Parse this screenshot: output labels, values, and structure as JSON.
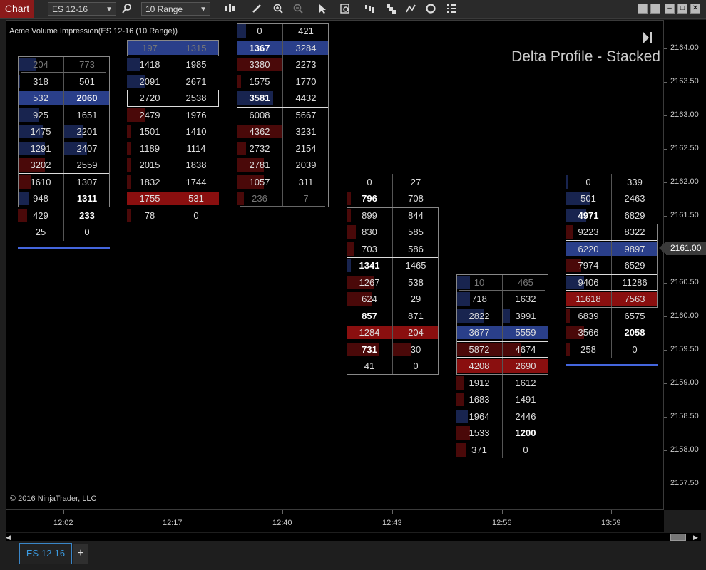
{
  "toolbar": {
    "chart_label": "Chart",
    "instrument": "ES 12-16",
    "interval": "10 Range"
  },
  "chart": {
    "indicator_title": "Acme Volume Impression(ES 12-16 (10 Range))",
    "heading": "Delta Profile - Stacked",
    "copyright": "© 2016 NinjaTrader, LLC",
    "current_price": "2161.00"
  },
  "yaxis_labels": [
    "2164.00",
    "2163.50",
    "2163.00",
    "2162.50",
    "2162.00",
    "2161.50",
    "2161.00",
    "2160.50",
    "2160.00",
    "2159.50",
    "2159.00",
    "2158.50",
    "2158.00",
    "2157.50"
  ],
  "xaxis_labels": [
    "12:02",
    "12:17",
    "12:40",
    "12:43",
    "12:56",
    "13:59"
  ],
  "tab": {
    "label": "ES 12-16",
    "add": "+"
  },
  "colors": {
    "bid_red": "#8a0f0f",
    "ask_blue": "#2a3f8a",
    "bg": "#000000"
  },
  "bars": [
    {
      "time": "12:02",
      "top_row": 1,
      "rows": [
        {
          "l": "204",
          "r": "773",
          "lb": 0.4,
          "lc": "b",
          "rb": 0,
          "rc": "b",
          "head": true
        },
        {
          "l": "318",
          "r": "501",
          "lb": 0.05,
          "lc": "b",
          "rb": 0,
          "rc": "b"
        },
        {
          "l": "532",
          "r": "2060",
          "lb": 1,
          "lc": "B",
          "rb": 1,
          "rc": "B",
          "rbold": true
        },
        {
          "l": "925",
          "r": "1651",
          "lb": 0.45,
          "lc": "b",
          "rb": 0,
          "rc": "b"
        },
        {
          "l": "1475",
          "r": "2201",
          "lb": 0.55,
          "lc": "b",
          "rb": 0.4,
          "rc": "b"
        },
        {
          "l": "1291",
          "r": "2407",
          "lb": 0.6,
          "lc": "b",
          "rb": 0.5,
          "rc": "b"
        },
        {
          "l": "3202",
          "r": "2559",
          "lb": 0.6,
          "lc": "r",
          "rb": 0,
          "rc": "b",
          "box": true
        },
        {
          "l": "1610",
          "r": "1307",
          "lb": 0.3,
          "lc": "r",
          "rb": 0,
          "rc": "b"
        },
        {
          "l": "948",
          "r": "1311",
          "lb": 0.25,
          "lc": "b",
          "rb": 0,
          "rc": "b",
          "rbold": true
        },
        {
          "l": "429",
          "r": "233",
          "lb": 0.2,
          "lc": "r",
          "rb": 0,
          "rc": "b",
          "rbold": true
        },
        {
          "l": "25",
          "r": "0",
          "lb": 0,
          "lc": "b",
          "rb": 0,
          "rc": "b"
        }
      ],
      "underline": true
    },
    {
      "time": "12:17",
      "top_row": 0,
      "rows": [
        {
          "l": "197",
          "r": "1315",
          "lb": 1,
          "lc": "B",
          "rb": 1,
          "rc": "B",
          "head": true
        },
        {
          "l": "1418",
          "r": "1985",
          "lb": 0.3,
          "lc": "b",
          "rb": 0,
          "rc": "b"
        },
        {
          "l": "2091",
          "r": "2671",
          "lb": 0.4,
          "lc": "b",
          "rb": 0,
          "rc": "b"
        },
        {
          "l": "2720",
          "r": "2538",
          "lb": 0,
          "lc": "b",
          "rb": 0,
          "rc": "b",
          "box": true
        },
        {
          "l": "2479",
          "r": "1976",
          "lb": 0.4,
          "lc": "r",
          "rb": 0,
          "rc": "b"
        },
        {
          "l": "1501",
          "r": "1410",
          "lb": 0.1,
          "lc": "r",
          "rb": 0,
          "rc": "b"
        },
        {
          "l": "1189",
          "r": "1114",
          "lb": 0.1,
          "lc": "r",
          "rb": 0,
          "rc": "b"
        },
        {
          "l": "2015",
          "r": "1838",
          "lb": 0.1,
          "lc": "r",
          "rb": 0,
          "rc": "b"
        },
        {
          "l": "1832",
          "r": "1744",
          "lb": 0.1,
          "lc": "r",
          "rb": 0,
          "rc": "b"
        },
        {
          "l": "1755",
          "r": "531",
          "lb": 1,
          "lc": "R",
          "rb": 1,
          "rc": "R"
        },
        {
          "l": "78",
          "r": "0",
          "lb": 0.1,
          "lc": "r",
          "rb": 0,
          "rc": "b"
        }
      ]
    },
    {
      "time": "12:40",
      "top_row": -1,
      "rows": [
        {
          "l": "0",
          "r": "421",
          "lb": 0.2,
          "lc": "b",
          "rb": 0,
          "rc": "b"
        },
        {
          "l": "1367",
          "r": "3284",
          "lb": 1,
          "lc": "B",
          "rb": 1,
          "rc": "B",
          "lbold": true
        },
        {
          "l": "3380",
          "r": "2273",
          "lb": 1,
          "lc": "r",
          "rb": 0,
          "rc": "b"
        },
        {
          "l": "1575",
          "r": "1770",
          "lb": 0.1,
          "lc": "r",
          "rb": 0,
          "rc": "b"
        },
        {
          "l": "3581",
          "r": "4432",
          "lb": 0.8,
          "lc": "b",
          "rb": 0,
          "rc": "b",
          "lbold": true
        },
        {
          "l": "6008",
          "r": "5667",
          "lb": 0,
          "lc": "b",
          "rb": 0,
          "rc": "b",
          "box": true
        },
        {
          "l": "4362",
          "r": "3231",
          "lb": 1,
          "lc": "r",
          "rb": 0,
          "rc": "b"
        },
        {
          "l": "2732",
          "r": "2154",
          "lb": 0.2,
          "lc": "r",
          "rb": 0,
          "rc": "b"
        },
        {
          "l": "2781",
          "r": "2039",
          "lb": 0.6,
          "lc": "r",
          "rb": 0,
          "rc": "b"
        },
        {
          "l": "1057",
          "r": "311",
          "lb": 0.6,
          "lc": "r",
          "rb": 0,
          "rc": "b"
        },
        {
          "l": "236",
          "r": "7",
          "lb": 0.15,
          "lc": "r",
          "rb": 0,
          "rc": "b",
          "head": true
        }
      ]
    },
    {
      "time": "12:43",
      "top_row": 8,
      "rows": [
        {
          "l": "0",
          "r": "27",
          "lb": 0,
          "lc": "b",
          "rb": 0,
          "rc": "b"
        },
        {
          "l": "796",
          "r": "708",
          "lb": 0.1,
          "lc": "r",
          "rb": 0,
          "rc": "b",
          "lbold": true
        },
        {
          "l": "899",
          "r": "844",
          "lb": 0.1,
          "lc": "r",
          "rb": 0,
          "rc": "b"
        },
        {
          "l": "830",
          "r": "585",
          "lb": 0.2,
          "lc": "r",
          "rb": 0,
          "rc": "b"
        },
        {
          "l": "703",
          "r": "586",
          "lb": 0.15,
          "lc": "r",
          "rb": 0,
          "rc": "b"
        },
        {
          "l": "1341",
          "r": "1465",
          "lb": 0.1,
          "lc": "b",
          "rb": 0,
          "rc": "b",
          "box": true,
          "lbold": true
        },
        {
          "l": "1267",
          "r": "538",
          "lb": 0.6,
          "lc": "r",
          "rb": 0,
          "rc": "b"
        },
        {
          "l": "624",
          "r": "29",
          "lb": 0.55,
          "lc": "r",
          "rb": 0,
          "rc": "b"
        },
        {
          "l": "857",
          "r": "871",
          "lb": 0,
          "lc": "b",
          "rb": 0,
          "rc": "b",
          "lbold": true
        },
        {
          "l": "1284",
          "r": "204",
          "lb": 1,
          "lc": "R",
          "rb": 1,
          "rc": "R"
        },
        {
          "l": "731",
          "r": "30",
          "lb": 0.7,
          "lc": "r",
          "rb": 0.4,
          "rc": "r",
          "lbold": true
        },
        {
          "l": "41",
          "r": "0",
          "lb": 0,
          "lc": "b",
          "rb": 0,
          "rc": "b"
        }
      ]
    },
    {
      "time": "12:56",
      "top_row": 14,
      "rows": [
        {
          "l": "10",
          "r": "465",
          "lb": 0.3,
          "lc": "b",
          "rb": 0,
          "rc": "b",
          "head": true
        },
        {
          "l": "718",
          "r": "1632",
          "lb": 0.3,
          "lc": "b",
          "rb": 0,
          "rc": "b"
        },
        {
          "l": "2822",
          "r": "3991",
          "lb": 0.6,
          "lc": "b",
          "rb": 0.15,
          "rc": "b"
        },
        {
          "l": "3677",
          "r": "5559",
          "lb": 1,
          "lc": "B",
          "rb": 1,
          "rc": "B"
        },
        {
          "l": "5872",
          "r": "4674",
          "lb": 1,
          "lc": "r",
          "rb": 0.4,
          "rc": "r",
          "box": true
        },
        {
          "l": "4208",
          "r": "2690",
          "lb": 1,
          "lc": "R",
          "rb": 1,
          "rc": "R"
        },
        {
          "l": "1912",
          "r": "1612",
          "lb": 0.15,
          "lc": "r",
          "rb": 0,
          "rc": "b"
        },
        {
          "l": "1683",
          "r": "1491",
          "lb": 0.15,
          "lc": "r",
          "rb": 0,
          "rc": "b"
        },
        {
          "l": "1964",
          "r": "2446",
          "lb": 0.25,
          "lc": "b",
          "rb": 0,
          "rc": "b"
        },
        {
          "l": "1533",
          "r": "1200",
          "lb": 0.3,
          "lc": "r",
          "rb": 0,
          "rc": "b",
          "rbold": true
        },
        {
          "l": "371",
          "r": "0",
          "lb": 0.2,
          "lc": "r",
          "rb": 0,
          "rc": "b"
        }
      ]
    },
    {
      "time": "13:59",
      "top_row": 8,
      "rows": [
        {
          "l": "0",
          "r": "339",
          "lb": 0.05,
          "lc": "b",
          "rb": 0,
          "rc": "b"
        },
        {
          "l": "501",
          "r": "2463",
          "lb": 0.55,
          "lc": "b",
          "rb": 0,
          "rc": "b"
        },
        {
          "l": "4971",
          "r": "6829",
          "lb": 0.45,
          "lc": "b",
          "rb": 0,
          "rc": "b",
          "lbold": true
        },
        {
          "l": "9223",
          "r": "8322",
          "lb": 0.15,
          "lc": "r",
          "rb": 0,
          "rc": "b",
          "box": true
        },
        {
          "l": "6220",
          "r": "9897",
          "lb": 1,
          "lc": "B",
          "rb": 1,
          "rc": "B"
        },
        {
          "l": "7974",
          "r": "6529",
          "lb": 0.35,
          "lc": "r",
          "rb": 0,
          "rc": "b"
        },
        {
          "l": "9406",
          "r": "11286",
          "lb": 0.4,
          "lc": "b",
          "rb": 0,
          "rc": "b",
          "boxw": true
        },
        {
          "l": "11618",
          "r": "7563",
          "lb": 1,
          "lc": "R",
          "rb": 1,
          "rc": "R"
        },
        {
          "l": "6839",
          "r": "6575",
          "lb": 0.1,
          "lc": "r",
          "rb": 0,
          "rc": "b"
        },
        {
          "l": "3566",
          "r": "2058",
          "lb": 0.4,
          "lc": "r",
          "rb": 0,
          "rc": "b",
          "rbold": true
        },
        {
          "l": "258",
          "r": "0",
          "lb": 0.1,
          "lc": "r",
          "rb": 0,
          "rc": "b"
        }
      ],
      "underline": true
    }
  ]
}
